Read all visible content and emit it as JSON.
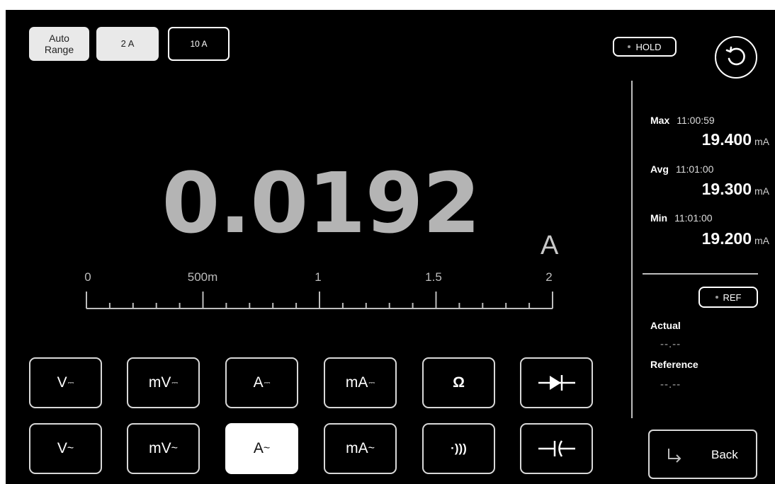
{
  "range_buttons": {
    "auto": "Auto Range",
    "r2a": "2 A",
    "r10a": "10 A"
  },
  "hold_label": "HOLD",
  "reading": {
    "value": "0.0192",
    "unit": "A"
  },
  "scale": {
    "labels": [
      "0",
      "500m",
      "1",
      "1.5",
      "2"
    ]
  },
  "stats": {
    "max": {
      "label": "Max",
      "time": "11:00:59",
      "value": "19.400",
      "unit": "mA"
    },
    "avg": {
      "label": "Avg",
      "time": "11:01:00",
      "value": "19.300",
      "unit": "mA"
    },
    "min": {
      "label": "Min",
      "time": "11:01:00",
      "value": "19.200",
      "unit": "mA"
    }
  },
  "ref_label": "REF",
  "actual": {
    "label": "Actual",
    "value": "--.--"
  },
  "reference": {
    "label": "Reference",
    "value": "--.--"
  },
  "modes_row1": [
    {
      "base": "V",
      "sym": "⎓"
    },
    {
      "base": "mV",
      "sym": "⎓"
    },
    {
      "base": "A",
      "sym": "⎓"
    },
    {
      "base": "mA",
      "sym": "⎓"
    },
    {
      "base": "Ω",
      "sym": ""
    }
  ],
  "modes_row2": [
    {
      "base": "V",
      "sym": "~"
    },
    {
      "base": "mV",
      "sym": "~"
    },
    {
      "base": "A",
      "sym": "~"
    },
    {
      "base": "mA",
      "sym": "~"
    },
    {
      "base": "·)))",
      "sym": ""
    }
  ],
  "active_mode": "A~",
  "back_label": "Back",
  "colors": {
    "background": "#000000",
    "reading": "#b4b4b4",
    "active_button": "#ffffff"
  },
  "icons": [
    "reset-icon",
    "diode-icon",
    "capacitor-icon",
    "return-arrow-icon"
  ]
}
